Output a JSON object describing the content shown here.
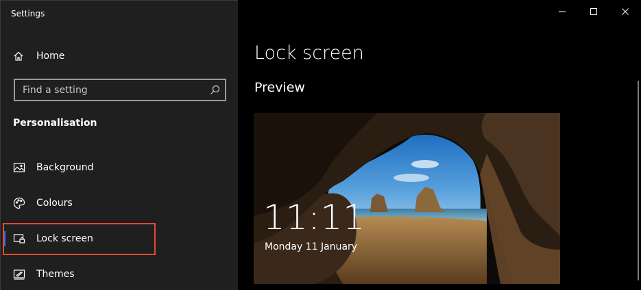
{
  "window": {
    "title": "Settings"
  },
  "sidebar": {
    "home_label": "Home",
    "search": {
      "placeholder": "Find a setting",
      "value": ""
    },
    "section_title": "Personalisation",
    "items": [
      {
        "label": "Background",
        "icon": "image-icon",
        "selected": false
      },
      {
        "label": "Colours",
        "icon": "palette-icon",
        "selected": false
      },
      {
        "label": "Lock screen",
        "icon": "lock-screen-icon",
        "selected": true
      },
      {
        "label": "Themes",
        "icon": "themes-icon",
        "selected": false
      }
    ]
  },
  "main": {
    "title": "Lock screen",
    "preview_heading": "Preview",
    "preview": {
      "time": "11:11",
      "date": "Monday 11 January"
    }
  },
  "colors": {
    "accent": "#3b72d9",
    "highlight": "#e04b32",
    "sidebar_bg": "#1f1f1f"
  }
}
